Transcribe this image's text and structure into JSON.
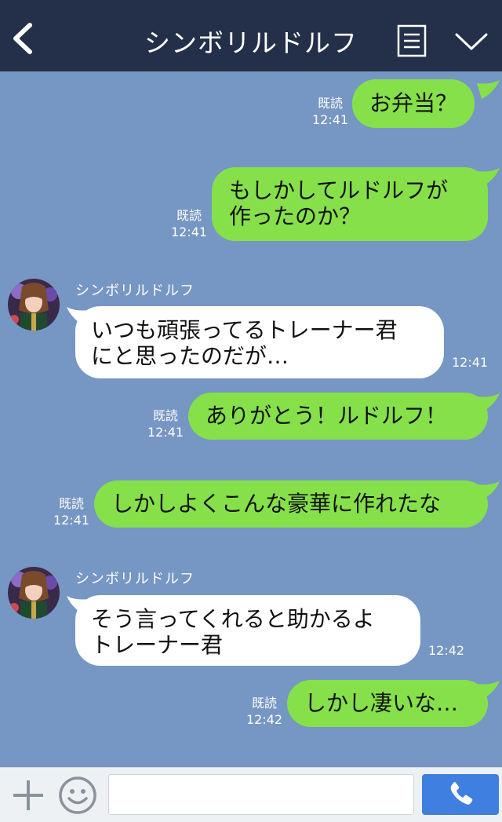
{
  "header": {
    "title": "シンボリルドルフ"
  },
  "colors": {
    "header_bg": "#243049",
    "chat_bg": "#7696c4",
    "outgoing_bubble": "#86e04a",
    "incoming_bubble": "#ffffff",
    "send_button": "#3f7fe0"
  },
  "messages": [
    {
      "direction": "out",
      "lines": [
        "お弁当？"
      ],
      "read": "既読",
      "time": "12:41"
    },
    {
      "direction": "out",
      "lines": [
        "もしかしてルドルフが",
        "作ったのか？"
      ],
      "read": "既読",
      "time": "12:41"
    },
    {
      "direction": "in",
      "sender": "シンボリルドルフ",
      "lines": [
        "いつも頑張ってるトレーナー君",
        "にと思ったのだが…"
      ],
      "time": "12:41"
    },
    {
      "direction": "out",
      "lines": [
        "ありがとう！ルドルフ！"
      ],
      "read": "既読",
      "time": "12:41"
    },
    {
      "direction": "out",
      "lines": [
        "しかしよくこんな豪華に作れたな"
      ],
      "read": "既読",
      "time": "12:41"
    },
    {
      "direction": "in",
      "sender": "シンボリルドルフ",
      "lines": [
        "そう言ってくれると助かるよ",
        "トレーナー君"
      ],
      "time": "12:42"
    },
    {
      "direction": "out",
      "lines": [
        "しかし凄いな…"
      ],
      "read": "既読",
      "time": "12:42"
    }
  ],
  "icons": {
    "back": "chevron-left-icon",
    "menu": "menu-icon",
    "collapse": "chevron-down-icon",
    "add": "plus-icon",
    "emoji": "smiley-icon",
    "call": "phone-icon"
  },
  "footer": {
    "input_value": "",
    "input_placeholder": ""
  }
}
